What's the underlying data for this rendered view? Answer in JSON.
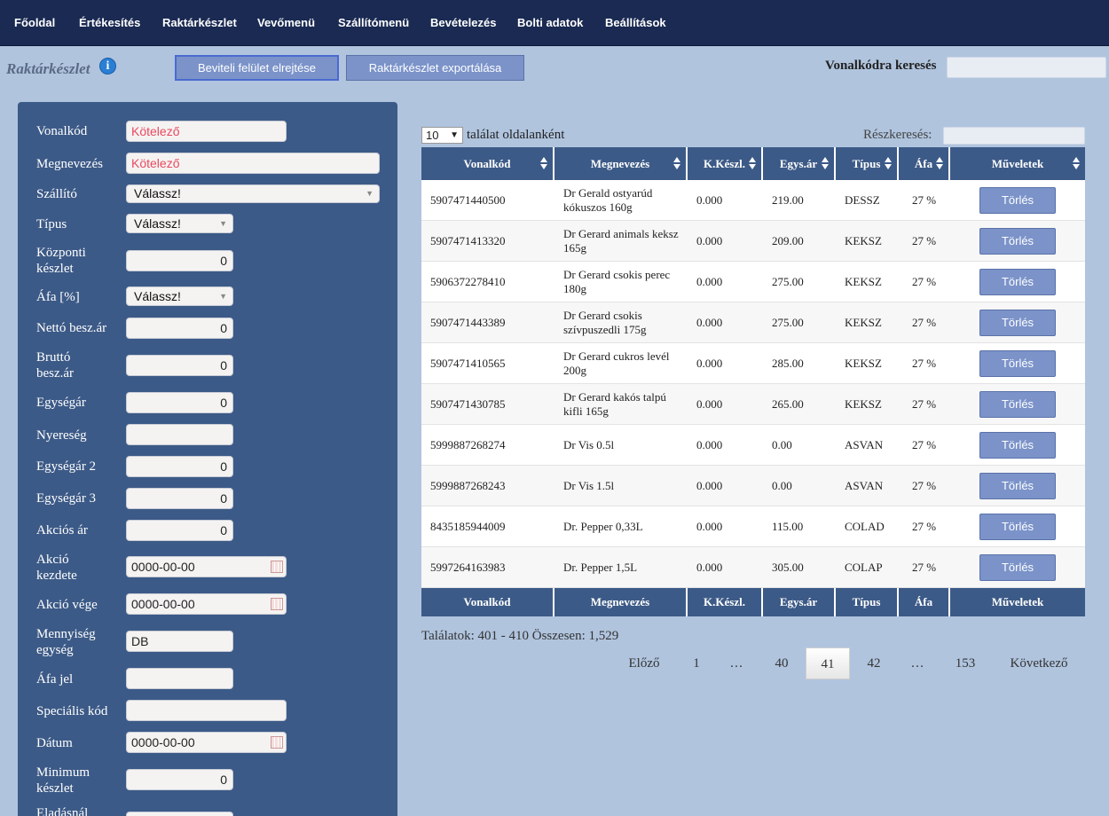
{
  "nav": {
    "items": [
      "Főoldal",
      "Értékesítés",
      "Raktárkészlet",
      "Vevőmenü",
      "Szállítómenü",
      "Bevételezés",
      "Bolti adatok",
      "Beállítások"
    ]
  },
  "header": {
    "title": "Raktárkészlet",
    "info_icon": "i",
    "hide_button": "Beviteli felület elrejtése",
    "export_button": "Raktárkészlet exportálása",
    "barcode_search_label": "Vonalkódra keresés",
    "barcode_search_value": ""
  },
  "form": {
    "fields": [
      {
        "label": "Vonalkód",
        "value": "Kötelező",
        "kind": "required"
      },
      {
        "label": "Megnevezés",
        "value": "Kötelező",
        "kind": "required"
      },
      {
        "label": "Szállító",
        "value": "Válassz!",
        "kind": "select"
      },
      {
        "label": "Típus",
        "value": "Válassz!",
        "kind": "select"
      },
      {
        "label": "Központi készlet",
        "value": "0",
        "kind": "number"
      },
      {
        "label": "Áfa [%]",
        "value": "Válassz!",
        "kind": "select"
      },
      {
        "label": "Nettó besz.ár",
        "value": "0",
        "kind": "number"
      },
      {
        "label": "Bruttó besz.ár",
        "value": "0",
        "kind": "number"
      },
      {
        "label": "Egységár",
        "value": "0",
        "kind": "number"
      },
      {
        "label": "Nyereség",
        "value": "",
        "kind": "text"
      },
      {
        "label": "Egységár 2",
        "value": "0",
        "kind": "number"
      },
      {
        "label": "Egységár 3",
        "value": "0",
        "kind": "number"
      },
      {
        "label": "Akciós ár",
        "value": "0",
        "kind": "number"
      },
      {
        "label": "Akció kezdete",
        "value": "0000-00-00",
        "kind": "date"
      },
      {
        "label": "Akció vége",
        "value": "0000-00-00",
        "kind": "date"
      },
      {
        "label": "Mennyiség egység",
        "value": "DB",
        "kind": "text"
      },
      {
        "label": "Áfa jel",
        "value": "",
        "kind": "text"
      },
      {
        "label": "Speciális kód",
        "value": "",
        "kind": "text"
      },
      {
        "label": "Dátum",
        "value": "0000-00-00",
        "kind": "date"
      },
      {
        "label": "Minimum készlet",
        "value": "0",
        "kind": "number"
      },
      {
        "label": "Eladásnál",
        "value": "",
        "kind": "text"
      }
    ]
  },
  "table": {
    "per_page_value": "10",
    "per_page_label": "találat oldalanként",
    "partial_search_label": "Részkeresés:",
    "partial_search_value": "",
    "columns": [
      "Vonalkód",
      "Megnevezés",
      "K.Készl.",
      "Egys.ár",
      "Típus",
      "Áfa",
      "Műveletek"
    ],
    "delete_label": "Törlés",
    "rows": [
      {
        "barcode": "5907471440500",
        "name": "Dr Gerald ostyarúd kókuszos 160g",
        "stock": "0.000",
        "price": "219.00",
        "type": "DESSZ",
        "vat": "27 %"
      },
      {
        "barcode": "5907471413320",
        "name": "Dr Gerard animals keksz 165g",
        "stock": "0.000",
        "price": "209.00",
        "type": "KEKSZ",
        "vat": "27 %"
      },
      {
        "barcode": "5906372278410",
        "name": "Dr Gerard csokis perec 180g",
        "stock": "0.000",
        "price": "275.00",
        "type": "KEKSZ",
        "vat": "27 %"
      },
      {
        "barcode": "5907471443389",
        "name": "Dr Gerard csokis szívpuszedli 175g",
        "stock": "0.000",
        "price": "275.00",
        "type": "KEKSZ",
        "vat": "27 %"
      },
      {
        "barcode": "5907471410565",
        "name": "Dr Gerard cukros levél 200g",
        "stock": "0.000",
        "price": "285.00",
        "type": "KEKSZ",
        "vat": "27 %"
      },
      {
        "barcode": "5907471430785",
        "name": "Dr Gerard kakós talpú kifli 165g",
        "stock": "0.000",
        "price": "265.00",
        "type": "KEKSZ",
        "vat": "27 %"
      },
      {
        "barcode": "5999887268274",
        "name": "Dr Vis 0.5l",
        "stock": "0.000",
        "price": "0.00",
        "type": "ASVAN",
        "vat": "27 %"
      },
      {
        "barcode": "5999887268243",
        "name": "Dr Vis 1.5l",
        "stock": "0.000",
        "price": "0.00",
        "type": "ASVAN",
        "vat": "27 %"
      },
      {
        "barcode": "8435185944009",
        "name": "Dr. Pepper 0,33L",
        "stock": "0.000",
        "price": "115.00",
        "type": "COLAD",
        "vat": "27 %"
      },
      {
        "barcode": "5997264163983",
        "name": "Dr. Pepper 1,5L",
        "stock": "0.000",
        "price": "305.00",
        "type": "COLAP",
        "vat": "27 %"
      }
    ],
    "results_text": "Találatok: 401 - 410 Összesen: 1,529"
  },
  "pagination": {
    "prev": "Előző",
    "pages": [
      "1",
      "…",
      "40",
      "41",
      "42",
      "…",
      "153"
    ],
    "current": "41",
    "next": "Következő"
  }
}
